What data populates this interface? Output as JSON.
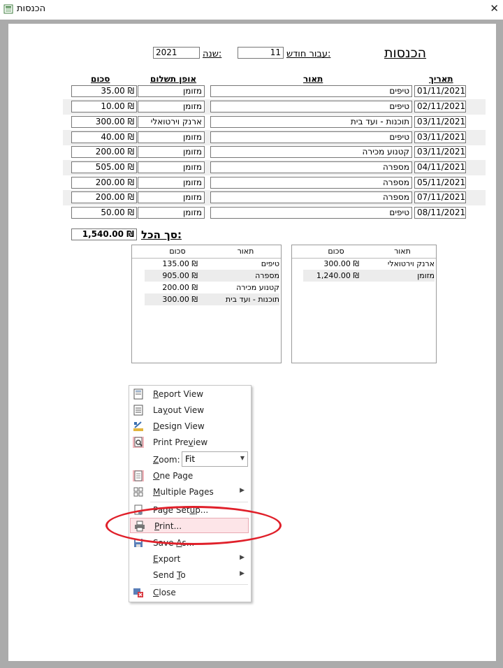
{
  "window": {
    "title": "הכנסות",
    "close_glyph": "✕"
  },
  "report": {
    "title": "הכנסות",
    "month_label": "עבור חודש:",
    "month_value": "11",
    "year_label": "שנה:",
    "year_value": "2021",
    "columns": {
      "date": "תאריך",
      "description": "תאור",
      "payment": "אופן תשלום",
      "amount": "סכום"
    },
    "rows": [
      {
        "date": "01/11/2021",
        "description": "טיפים",
        "payment": "מזומן",
        "amount": "₪ 35.00"
      },
      {
        "date": "02/11/2021",
        "description": "טיפים",
        "payment": "מזומן",
        "amount": "₪ 10.00"
      },
      {
        "date": "03/11/2021",
        "description": "תוכנות - ועד בית",
        "payment": "ארנק וירטואלי",
        "amount": "₪ 300.00"
      },
      {
        "date": "03/11/2021",
        "description": "טיפים",
        "payment": "מזומן",
        "amount": "₪ 40.00"
      },
      {
        "date": "03/11/2021",
        "description": "קטנוע מכירה",
        "payment": "מזומן",
        "amount": "₪ 200.00"
      },
      {
        "date": "04/11/2021",
        "description": "מספרה",
        "payment": "מזומן",
        "amount": "₪ 505.00"
      },
      {
        "date": "05/11/2021",
        "description": "מספרה",
        "payment": "מזומן",
        "amount": "₪ 200.00"
      },
      {
        "date": "07/11/2021",
        "description": "מספרה",
        "payment": "מזומן",
        "amount": "₪ 200.00"
      },
      {
        "date": "08/11/2021",
        "description": "טיפים",
        "payment": "מזומן",
        "amount": "₪ 50.00"
      }
    ],
    "total_label": "סך הכל:",
    "total_value": "₪ 1,540.00"
  },
  "summary_by_payment": {
    "col_description": "תאור",
    "col_amount": "סכום",
    "rows": [
      {
        "description": "ארנק וירטואלי",
        "amount": "₪ 300.00"
      },
      {
        "description": "מזומן",
        "amount": "₪ 1,240.00"
      }
    ]
  },
  "summary_by_description": {
    "col_description": "תאור",
    "col_amount": "סכום",
    "rows": [
      {
        "description": "טיפים",
        "amount": "₪ 135.00"
      },
      {
        "description": "מספרה",
        "amount": "₪ 905.00"
      },
      {
        "description": "קטנוע מכירה",
        "amount": "₪ 200.00"
      },
      {
        "description": "תוכנות - ועד בית",
        "amount": "₪ 300.00"
      }
    ]
  },
  "context_menu": {
    "report_view": {
      "pre": "",
      "key": "R",
      "post": "eport View"
    },
    "layout_view": {
      "pre": "La",
      "key": "y",
      "post": "out View"
    },
    "design_view": {
      "pre": "",
      "key": "D",
      "post": "esign View"
    },
    "print_preview": {
      "pre": "Print Pre",
      "key": "v",
      "post": "iew"
    },
    "zoom": {
      "pre": "",
      "key": "Z",
      "post": "oom:"
    },
    "zoom_value": "Fit",
    "one_page": {
      "pre": "",
      "key": "O",
      "post": "ne Page"
    },
    "multiple_pages": {
      "pre": "",
      "key": "M",
      "post": "ultiple Pages"
    },
    "page_setup": {
      "pre": "Page Set",
      "key": "u",
      "post": "p..."
    },
    "print": {
      "pre": "",
      "key": "P",
      "post": "rint..."
    },
    "save_as": {
      "pre": "Save ",
      "key": "A",
      "post": "s..."
    },
    "export": {
      "pre": "",
      "key": "E",
      "post": "xport"
    },
    "send_to": {
      "pre": "Send ",
      "key": "T",
      "post": "o"
    },
    "close": {
      "pre": "",
      "key": "C",
      "post": "lose"
    }
  },
  "colors": {
    "highlight_circle": "#e0202a",
    "menu_highlight": "#fde5e8"
  }
}
